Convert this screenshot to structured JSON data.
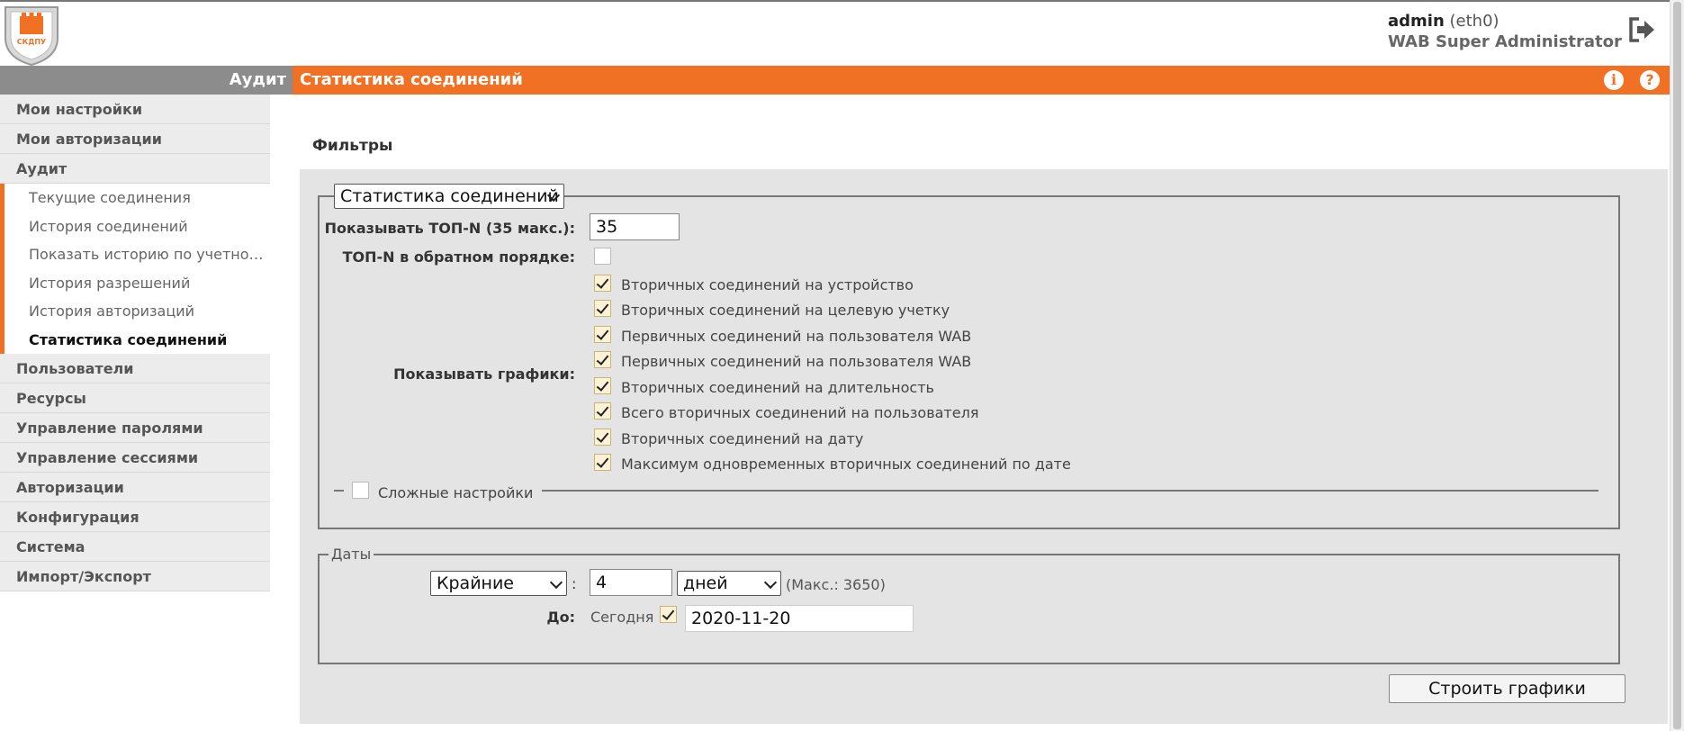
{
  "header": {
    "logo_text": "СКДПУ",
    "user_name": "admin",
    "user_iface": "(eth0)",
    "user_role": "WAB Super Administrator"
  },
  "titlebar": {
    "section": "Аудит",
    "title": "Статистика соединений",
    "info_icon": "i",
    "help_icon": "?"
  },
  "sidebar": {
    "items_top": [
      "Мои настройки",
      "Мои авторизации",
      "Аудит"
    ],
    "audit_sub": [
      "Текущие соединения",
      "История соединений",
      "Показать историю по учетной ...",
      "История разрешений",
      "История авторизаций",
      "Статистика соединений"
    ],
    "items_bottom": [
      "Пользователи",
      "Ресурсы",
      "Управление паролями",
      "Управление сессиями",
      "Авторизации",
      "Конфигурация",
      "Система",
      "Импорт/Экспорт"
    ]
  },
  "main": {
    "filters_title": "Фильтры",
    "stats_select": "Статистика соединений",
    "topn_label": "Показывать ТОП-N (35 макс.):",
    "topn_value": "35",
    "reverse_label": "ТОП-N в обратном порядке:",
    "charts_label": "Показывать графики:",
    "charts": [
      "Вторичных соединений на устройство",
      "Вторичных соединений на целевую учетку",
      "Первичных соединений на пользователя WAB",
      "Первичных соединений на пользователя WAB",
      "Вторичных соединений на длительность",
      "Всего вторичных соединений на пользователя",
      "Вторичных соединений на дату",
      "Максимум одновременных вторичных соединений по дате"
    ],
    "advanced_label": "Сложные настройки",
    "dates_legend": "Даты",
    "period_select": "Крайние",
    "colon": ":",
    "period_value": "4",
    "unit_select": "дней",
    "max_note": "(Макс.: 3650)",
    "to_label": "До:",
    "today_label": "Сегодня",
    "to_date": "2020-11-20",
    "build_button": "Строить графики"
  }
}
